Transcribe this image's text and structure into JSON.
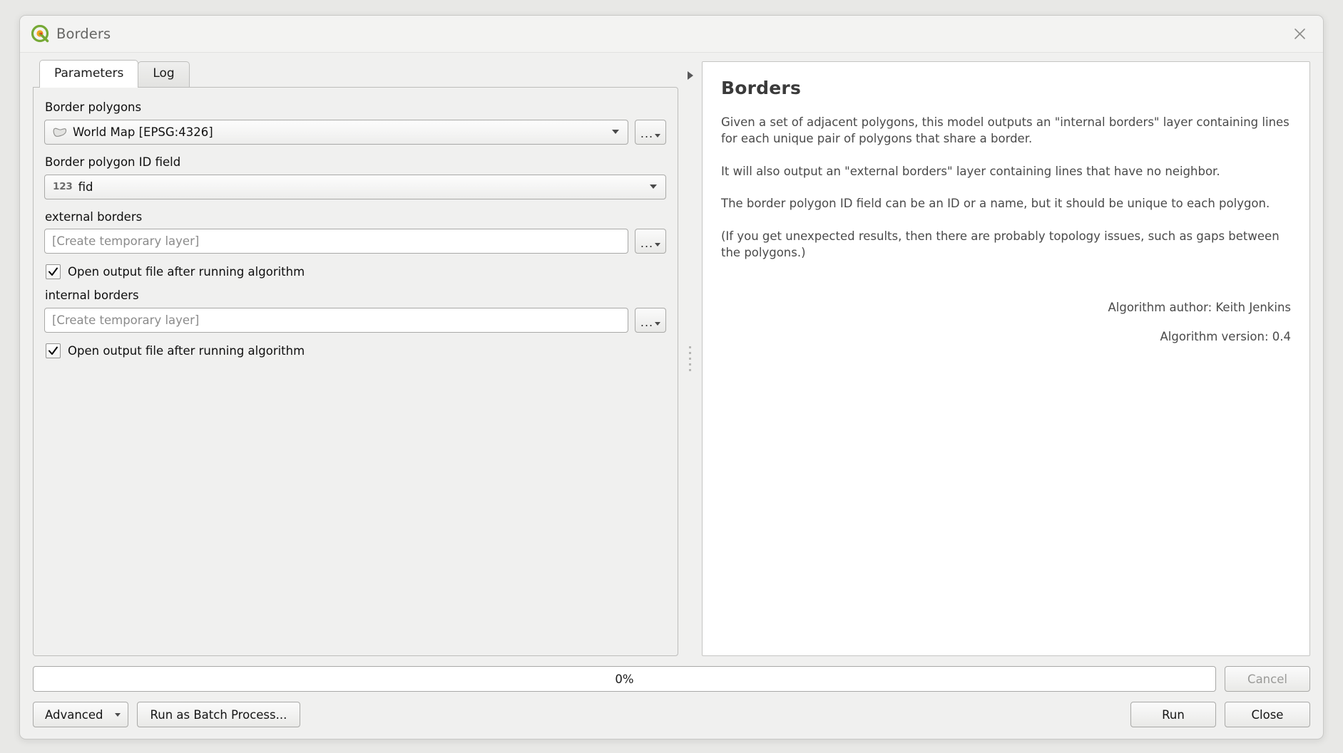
{
  "window": {
    "title": "Borders",
    "app_icon": "qgis-icon",
    "close_icon": "close-icon"
  },
  "tabs": [
    {
      "label": "Parameters",
      "active": true
    },
    {
      "label": "Log",
      "active": false
    }
  ],
  "parameters": {
    "border_polygons": {
      "label": "Border polygons",
      "value": "World Map [EPSG:4326]",
      "icon": "polygon-layer-icon",
      "browse_label": "..."
    },
    "border_polygon_id_field": {
      "label": "Border polygon ID field",
      "type_tag": "123",
      "value": "fid"
    },
    "external_borders": {
      "label": "external borders",
      "placeholder": "[Create temporary layer]",
      "value": "",
      "browse_label": "...",
      "open_output_label": "Open output file after running algorithm",
      "open_output_checked": true
    },
    "internal_borders": {
      "label": "internal borders",
      "placeholder": "[Create temporary layer]",
      "value": "",
      "browse_label": "...",
      "open_output_label": "Open output file after running algorithm",
      "open_output_checked": true
    }
  },
  "help": {
    "title": "Borders",
    "paragraphs": [
      "Given a set of adjacent polygons, this model outputs an \"internal borders\" layer containing lines for each unique pair of polygons that share a border.",
      "It will also output an \"external borders\" layer containing lines that have no neighbor.",
      "The border polygon ID field can be an ID or a name, but it should be unique to each polygon.",
      "(If you get unexpected results, then there are probably topology issues, such as gaps between the polygons.)"
    ],
    "author": "Algorithm author: Keith Jenkins",
    "version": "Algorithm version: 0.4"
  },
  "footer": {
    "progress_text": "0%",
    "progress_percent": 0,
    "cancel_label": "Cancel",
    "cancel_enabled": false,
    "advanced_label": "Advanced",
    "batch_label": "Run as Batch Process...",
    "run_label": "Run",
    "close_label": "Close"
  }
}
